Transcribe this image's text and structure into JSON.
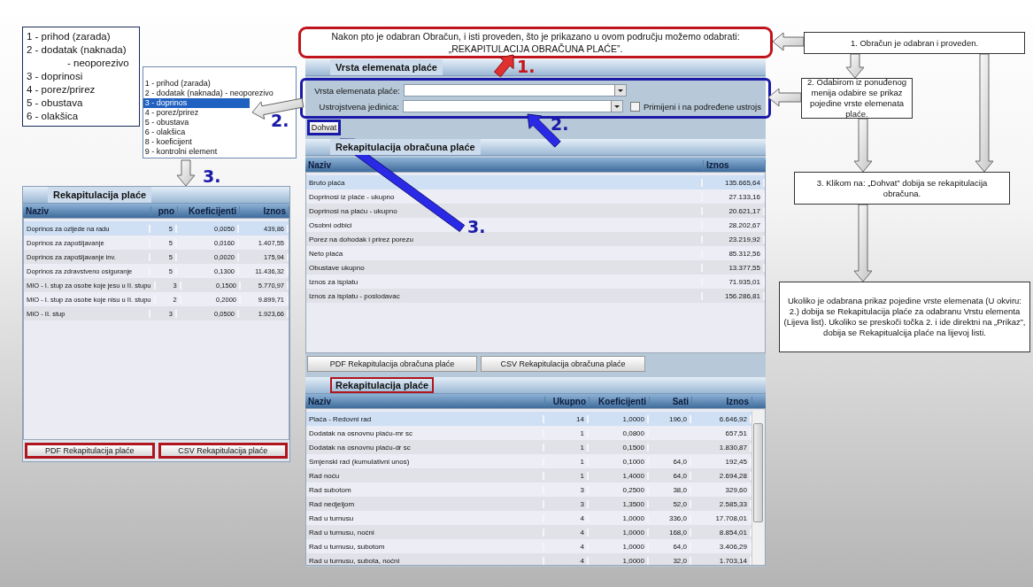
{
  "legend": {
    "items": [
      {
        "text": "1 - prihod (zarada)",
        "kind": "item"
      },
      {
        "text": "2 - dodatak (naknada)",
        "kind": "item"
      },
      {
        "text": "- neoporezivo",
        "kind": "continuation"
      },
      {
        "text": "3 - doprinosi",
        "kind": "item"
      },
      {
        "text": "4 - porez/prirez",
        "kind": "item"
      },
      {
        "text": "5 - obustava",
        "kind": "item"
      },
      {
        "text": "6 - olakšica",
        "kind": "item"
      }
    ]
  },
  "dropdown_list": {
    "options": [
      {
        "label": "1 - prihod (zarada)",
        "selected": false
      },
      {
        "label": "2 - dodatak (naknada) - neoporezivo",
        "selected": false
      },
      {
        "label": "3 - doprinos",
        "selected": true
      },
      {
        "label": "4 - porez/prirez",
        "selected": false
      },
      {
        "label": "5 - obustava",
        "selected": false
      },
      {
        "label": "6 - olakšica",
        "selected": false
      },
      {
        "label": "8 - koeficijent",
        "selected": false
      },
      {
        "label": "9 - kontrolni element",
        "selected": false
      }
    ]
  },
  "left_panel": {
    "title": "Rekapitulacija plaće",
    "columns": [
      "Naziv",
      "pno",
      "Koeficijenti",
      "Iznos"
    ],
    "rows": [
      {
        "cells": [
          "Doprinos za ozljede na radu",
          "5",
          "0,0050",
          "439,86"
        ],
        "selected": true
      },
      {
        "cells": [
          "Doprinos za zapošljavanje",
          "5",
          "0,0160",
          "1.407,55"
        ],
        "selected": false
      },
      {
        "cells": [
          "Doprinos za zapošljavanje inv.",
          "5",
          "0,0020",
          "175,94"
        ],
        "selected": false
      },
      {
        "cells": [
          "Doprinos za zdravstveno osiguranje",
          "5",
          "0,1300",
          "11.436,32"
        ],
        "selected": false
      },
      {
        "cells": [
          "MIO - I. stup za osobe koje jesu u II. stupu",
          "3",
          "0,1500",
          "5.770,97"
        ],
        "selected": false
      },
      {
        "cells": [
          "MIO - I. stup za osobe koje nisu u II. stupu",
          "2",
          "0,2000",
          "9.899,71"
        ],
        "selected": false
      },
      {
        "cells": [
          "MIO - II. stup",
          "3",
          "0,0500",
          "1.923,66"
        ],
        "selected": false
      }
    ],
    "buttons": [
      {
        "label": "PDF Rekapitulacija plaće",
        "highlighted": true
      },
      {
        "label": "CSV Rekapitulacija plaće",
        "highlighted": true
      }
    ]
  },
  "callout": {
    "lines": [
      "Nakon pto je odabran Obračun, i isti proveden, što je prikazano u ovom području možemo odabrati:",
      "„REKAPITULACIJA OBRAČUNA PLAĆE”."
    ]
  },
  "filter_panel": {
    "title": "Vrsta elemenata plaće",
    "highlighted": true,
    "fields": [
      {
        "label": "Vrsta elemenata plaće:"
      },
      {
        "label": "Ustrojstvena jedinica:"
      }
    ],
    "checkbox": {
      "label": "Primijeni i na podređene ustrojs",
      "checked": false
    },
    "fetch_button": {
      "label": "Dohvat",
      "highlighted": true
    }
  },
  "summary_panel": {
    "title": "Rekapitulacija obračuna plaće",
    "columns": [
      "Naziv",
      "Iznos"
    ],
    "rows": [
      {
        "cells": [
          "Bruto plaća",
          "135.665,64"
        ],
        "selected": true
      },
      {
        "cells": [
          "Doprinosi iz plaće - ukupno",
          "27.133,16"
        ],
        "selected": false
      },
      {
        "cells": [
          "Doprinosi na plaću - ukupno",
          "20.621,17"
        ],
        "selected": false
      },
      {
        "cells": [
          "Osobni odbici",
          "28.202,67"
        ],
        "selected": false
      },
      {
        "cells": [
          "Porez na dohodak i prirez porezu",
          "23.219,92"
        ],
        "selected": false
      },
      {
        "cells": [
          "Neto plaća",
          "85.312,56"
        ],
        "selected": false
      },
      {
        "cells": [
          "Obustave ukupno",
          "13.377,55"
        ],
        "selected": false
      },
      {
        "cells": [
          "Iznos za isplatu",
          "71.935,01"
        ],
        "selected": false
      },
      {
        "cells": [
          "Iznos za isplatu - poslodavac",
          "156.286,81"
        ],
        "selected": false
      }
    ],
    "buttons": [
      {
        "label": "PDF Rekapitulacija obračuna plaće",
        "highlighted": false
      },
      {
        "label": "CSV Rekapitulacija obračuna plaće",
        "highlighted": false
      }
    ]
  },
  "detail_panel": {
    "title": "Rekapitulacija plaće",
    "title_highlighted": true,
    "columns": [
      "Naziv",
      "Ukupno",
      "Koeficijenti",
      "Sati",
      "Iznos"
    ],
    "rows": [
      {
        "cells": [
          "Plaća - Redovni rad",
          "14",
          "1,0000",
          "196,0",
          "6.646,92"
        ],
        "selected": true
      },
      {
        "cells": [
          "Dodatak na osnovnu plaću-mr sc",
          "1",
          "0,0800",
          "",
          "657,51"
        ],
        "selected": false
      },
      {
        "cells": [
          "Dodatak na osnovnu plaću-dr sc",
          "1",
          "0,1500",
          "",
          "1.830,87"
        ],
        "selected": false
      },
      {
        "cells": [
          "Smjenski rad (kumulativni unos)",
          "1",
          "0,1000",
          "64,0",
          "192,45"
        ],
        "selected": false
      },
      {
        "cells": [
          "Rad noću",
          "1",
          "1,4000",
          "64,0",
          "2.694,28"
        ],
        "selected": false
      },
      {
        "cells": [
          "Rad subotom",
          "3",
          "0,2500",
          "38,0",
          "329,60"
        ],
        "selected": false
      },
      {
        "cells": [
          "Rad nedjeljom",
          "3",
          "1,3500",
          "52,0",
          "2.585,33"
        ],
        "selected": false
      },
      {
        "cells": [
          "Rad u turnusu",
          "4",
          "1,0000",
          "336,0",
          "17.708,01"
        ],
        "selected": false
      },
      {
        "cells": [
          "Rad u turnusu, noćni",
          "4",
          "1,0000",
          "168,0",
          "8.854,01"
        ],
        "selected": false
      },
      {
        "cells": [
          "Rad u turnusu, subotom",
          "4",
          "1,0000",
          "64,0",
          "3.406,29"
        ],
        "selected": false
      },
      {
        "cells": [
          "Rad u turnusu, subota, noćni",
          "4",
          "1,0000",
          "32,0",
          "1.703,14"
        ],
        "selected": false
      }
    ]
  },
  "flow_steps": [
    "1. Obračun je odabran i proveden.",
    "2. Odabirom iz ponuđenog menija  odabire se prikaz pojedine vrste elemenata plaće.",
    "3. Klikom na: „Dohvat” dobija se rekapitulacija obračuna.",
    "Ukoliko je odabrana prikaz pojedine vrste elemenata (U okviru: 2.) dobija se Rekapitulacija plaće za odabranu Vrstu elementa (Lijeva list). Ukoliko se preskoči točka 2. i ide direktni na „Prikaz”, dobija se Rekapitualcija plaće na lijevoj listi."
  ],
  "markers": [
    {
      "label": "1.",
      "color": "#c8141c"
    },
    {
      "label": "2.",
      "color": "#1a1aa8"
    },
    {
      "label": "2.",
      "color": "#1a1aa8"
    },
    {
      "label": "3.",
      "color": "#1a1aa8"
    },
    {
      "label": "3.",
      "color": "#1a1aa8"
    }
  ]
}
